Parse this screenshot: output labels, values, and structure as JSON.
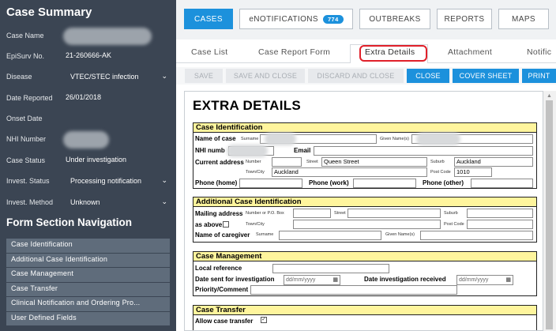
{
  "sidebar": {
    "title": "Case Summary",
    "fields": [
      {
        "label": "Case Name",
        "value": ""
      },
      {
        "label": "EpiSurv No.",
        "value": "21-260666-AK"
      },
      {
        "label": "Disease",
        "value": "VTEC/STEC infection"
      },
      {
        "label": "Date Reported",
        "value": "26/01/2018"
      },
      {
        "label": "Onset Date",
        "value": ""
      },
      {
        "label": "NHI Number",
        "value": ""
      },
      {
        "label": "Case Status",
        "value": "Under investigation"
      },
      {
        "label": "Invest. Status",
        "value": "Processing notification"
      },
      {
        "label": "Invest. Method",
        "value": "Unknown"
      }
    ],
    "nav_title": "Form Section Navigation",
    "nav_items": [
      "Case Identification",
      "Additional Case Identification",
      "Case Management",
      "Case Transfer",
      "Clinical Notification and Ordering Pro...",
      "User Defined Fields"
    ]
  },
  "topnav": {
    "cases": "CASES",
    "enotifications": "eNOTIFICATIONS",
    "enotifications_count": "774",
    "outbreaks": "OUTBREAKS",
    "reports": "REPORTS",
    "maps": "MAPS"
  },
  "subtabs": {
    "case_list": "Case List",
    "case_report_form": "Case Report Form",
    "extra_details": "Extra Details",
    "attachment": "Attachment",
    "notific": "Notific"
  },
  "actions": {
    "save": "SAVE",
    "save_and_close": "SAVE AND CLOSE",
    "discard_and_close": "DISCARD AND CLOSE",
    "close": "CLOSE",
    "cover_sheet": "COVER SHEET",
    "print": "PRINT"
  },
  "form": {
    "title": "EXTRA DETAILS",
    "case_identification": {
      "header": "Case Identification",
      "name_of_case": "Name of case",
      "surname": "Surname",
      "given_names": "Given Name(s)",
      "nhi_number": "NHI numb",
      "email": "Email",
      "current_address": "Current address",
      "number": "Number",
      "street": "Street",
      "street_value": "Queen Street",
      "suburb": "Suburb",
      "suburb_value": "Auckland",
      "town_city": "Town/City",
      "town_city_value": "Auckland",
      "post_code": "Post Code",
      "post_code_value": "1010",
      "phone_home": "Phone (home)",
      "phone_work": "Phone (work)",
      "phone_other": "Phone (other)"
    },
    "additional_case_identification": {
      "header": "Additional Case Identification",
      "mailing_address": "Mailing address",
      "number_or_po": "Number or P.O. Box",
      "street": "Street",
      "suburb": "Suburb",
      "as_above": "as above",
      "town_city": "Town/City",
      "post_code": "Post Code",
      "name_of_caregiver": "Name of caregiver",
      "surname": "Surname",
      "given_names": "Given Name(s)"
    },
    "case_management": {
      "header": "Case Management",
      "local_reference": "Local reference",
      "date_sent": "Date sent for investigation",
      "date_sent_placeholder": "dd/mm/yyyy",
      "date_received": "Date investigation received",
      "date_received_placeholder": "dd/mm/yyyy",
      "priority_comment": "Priority/Comment"
    },
    "case_transfer": {
      "header": "Case Transfer",
      "allow_case_transfer": "Allow case transfer"
    }
  },
  "colors": {
    "sidebar_bg": "#3b4553",
    "accent": "#1c91dc",
    "section_header": "#fff59d",
    "highlight_circle": "#e0202a"
  }
}
